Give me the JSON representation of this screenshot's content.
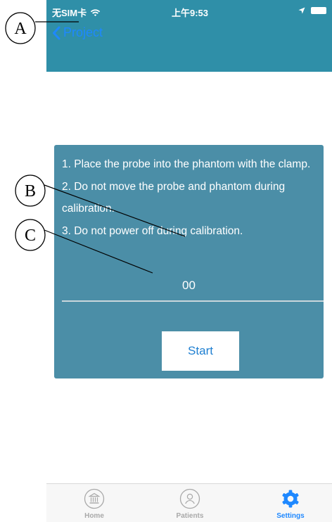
{
  "statusbar": {
    "carrier": "无SIM卡",
    "time": "上午9:53"
  },
  "navbar": {
    "back_label": "Project"
  },
  "card": {
    "instructions": [
      "1. Place the probe into the phantom with the clamp.",
      "2. Do not move the probe and phantom during calibration.",
      "3. Do not power off during calibration."
    ],
    "counter": "00",
    "start_label": "Start"
  },
  "tabbar": {
    "items": [
      {
        "label": "Home",
        "icon": "bank-icon",
        "active": false
      },
      {
        "label": "Patients",
        "icon": "person-icon",
        "active": false
      },
      {
        "label": "Settings",
        "icon": "gear-icon",
        "active": true
      }
    ]
  },
  "annotations": {
    "a": "A",
    "b": "B",
    "c": "C"
  },
  "colors": {
    "header": "#2f8fa8",
    "card": "#4b8ea7",
    "accent": "#1e88ff"
  }
}
